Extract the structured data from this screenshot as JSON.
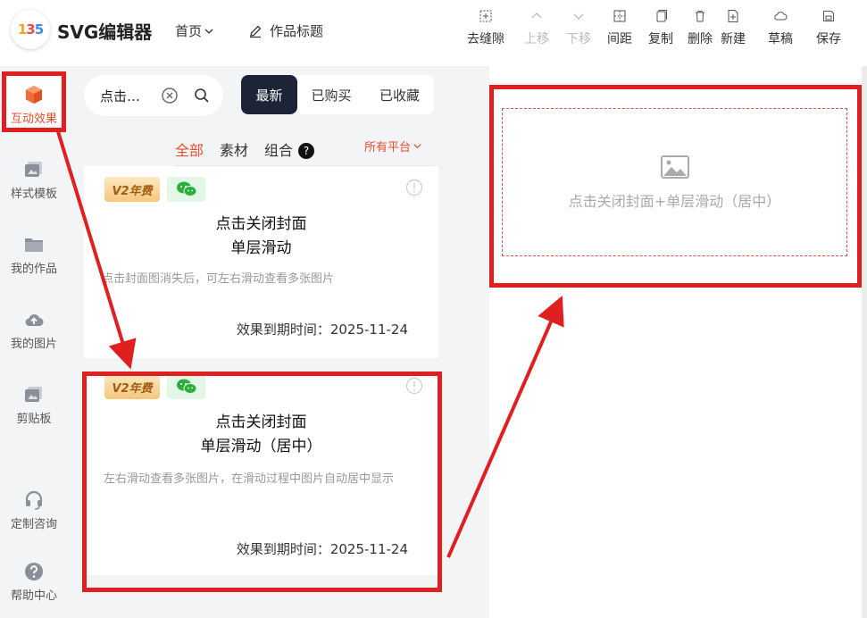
{
  "header": {
    "logo_letters": [
      "1",
      "3",
      "5"
    ],
    "app_title": "SVG编辑器",
    "nav_home": "首页",
    "nav_work_title": "作品标题"
  },
  "toolbar": [
    {
      "label": "去缝隙",
      "icon": "gap-icon",
      "disabled": false
    },
    {
      "label": "上移",
      "icon": "chevron-up-icon",
      "disabled": true
    },
    {
      "label": "下移",
      "icon": "chevron-down-icon",
      "disabled": true
    },
    {
      "label": "间距",
      "icon": "spacing-icon",
      "disabled": false
    },
    {
      "label": "复制",
      "icon": "copy-icon",
      "disabled": false
    },
    {
      "label": "删除",
      "icon": "trash-icon",
      "disabled": false
    },
    {
      "label": "新建",
      "icon": "new-file-icon",
      "disabled": false
    },
    {
      "label": "草稿",
      "icon": "cloud-icon",
      "disabled": false
    },
    {
      "label": "保存",
      "icon": "save-icon",
      "disabled": false
    }
  ],
  "sidebar": {
    "items": [
      {
        "label": "互动效果",
        "icon": "cube-icon",
        "active": true
      },
      {
        "label": "样式模板",
        "icon": "template-icon",
        "active": false
      },
      {
        "label": "我的作品",
        "icon": "folder-icon",
        "active": false
      },
      {
        "label": "我的图片",
        "icon": "cloud-upload-icon",
        "active": false
      },
      {
        "label": "剪贴板",
        "icon": "clipboard-icon",
        "active": false
      },
      {
        "label": "定制咨询",
        "icon": "headset-icon",
        "active": false
      },
      {
        "label": "帮助中心",
        "icon": "help-icon",
        "active": false
      }
    ]
  },
  "panel": {
    "search_value": "点击…",
    "segments": [
      "最新",
      "已购买",
      "已收藏"
    ],
    "tabs": [
      "全部",
      "素材",
      "组合"
    ],
    "tab_help": "?",
    "platform_filter": "所有平台",
    "cards": [
      {
        "badge": "V2年费",
        "title_line1": "点击关闭封面",
        "title_line2": "单层滑动",
        "description": "点击封面图消失后，可左右滑动查看多张图片",
        "expiry": "效果到期时间：2025-11-24"
      },
      {
        "badge": "V2年费",
        "title_line1": "点击关闭封面",
        "title_line2": "单层滑动（居中）",
        "description": "左右滑动查看多张图片，在滑动过程中图片自动居中显示",
        "expiry": "效果到期时间：2025-11-24"
      }
    ]
  },
  "preview": {
    "placeholder_label": "点击关闭封面+单层滑动（居中）",
    "icon": "image-icon"
  },
  "colors": {
    "accent": "#e84d2d",
    "highlight": "#e02020",
    "dark": "#1d2438"
  }
}
